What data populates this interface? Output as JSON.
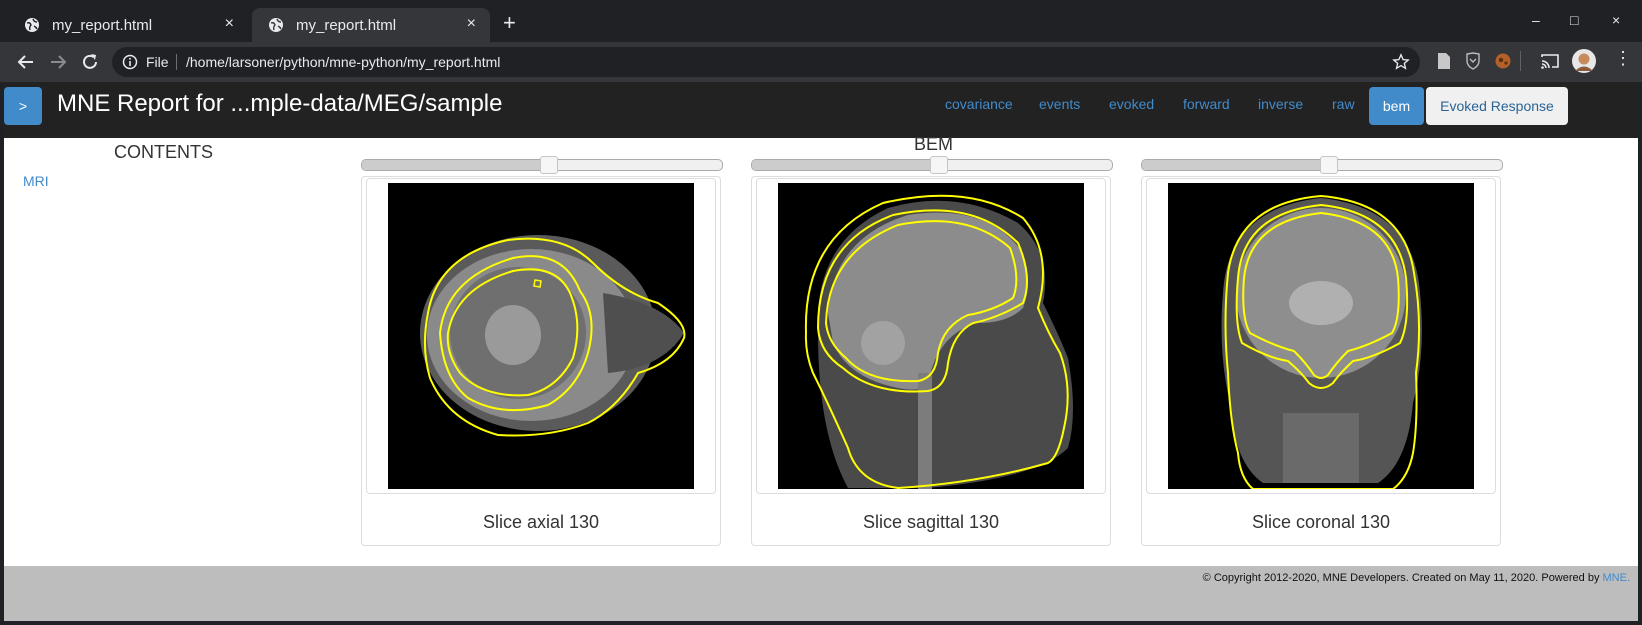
{
  "browser": {
    "tabs": [
      {
        "title": "my_report.html",
        "active": false
      },
      {
        "title": "my_report.html",
        "active": true
      }
    ],
    "tab_close_glyph": "×",
    "new_tab_glyph": "+",
    "window_controls": [
      "–",
      "□",
      "×"
    ],
    "address": {
      "scheme_label": "File",
      "url": "/home/larsoner/python/mne-python/my_report.html"
    }
  },
  "report": {
    "toggle_label": ">",
    "title": "MNE Report for ...mple-data/MEG/sample",
    "nav": [
      "covariance",
      "events",
      "evoked",
      "forward",
      "inverse",
      "raw"
    ],
    "nav_active": "bem",
    "nav_button": "Evoked Response",
    "toc_heading": "CONTENTS",
    "toc_items": [
      "MRI"
    ],
    "section_title": "BEM",
    "slices": [
      {
        "caption": "Slice axial 130",
        "slider_fraction": 0.52
      },
      {
        "caption": "Slice sagittal 130",
        "slider_fraction": 0.52
      },
      {
        "caption": "Slice coronal 130",
        "slider_fraction": 0.52
      }
    ],
    "footer_text": "© Copyright 2012-2020, MNE Developers. Created on May 11, 2020. Powered by ",
    "footer_link": "MNE."
  },
  "colors": {
    "accent": "#428bca",
    "navbar": "#222222",
    "browser_frame": "#202124",
    "toolbar": "#35363a",
    "footer": "#bdbdbd",
    "bem_contour": "#ffff00"
  },
  "icons": [
    "globe-icon",
    "back-arrow-icon",
    "forward-arrow-icon",
    "reload-icon",
    "info-icon",
    "star-icon",
    "document-icon",
    "shield-extension-icon",
    "extension-icon",
    "cast-icon",
    "profile-avatar"
  ]
}
